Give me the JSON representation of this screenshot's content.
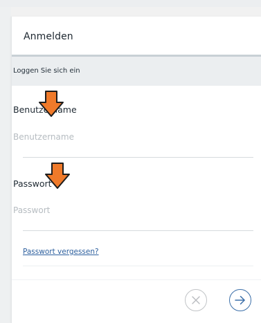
{
  "dialog": {
    "title": "Anmelden",
    "subtitle": "Loggen Sie sich ein"
  },
  "form": {
    "username": {
      "label": "Benutzername",
      "placeholder": "Benutzername",
      "value": ""
    },
    "password": {
      "label": "Passwort",
      "placeholder": "Passwort",
      "value": ""
    },
    "forgot_link": "Passwort vergessen?"
  },
  "actions": {
    "cancel_icon": "close-circle-icon",
    "submit_icon": "arrow-right-circle-icon"
  },
  "overlay": {
    "arrow_icon": "arrow-down-icon",
    "arrow_color": "#f07a2a"
  },
  "colors": {
    "accent": "#3a6ea8",
    "link": "#2c5f9e",
    "header_divider": "#c8d0d5",
    "subbar_bg": "#ebeef0"
  }
}
